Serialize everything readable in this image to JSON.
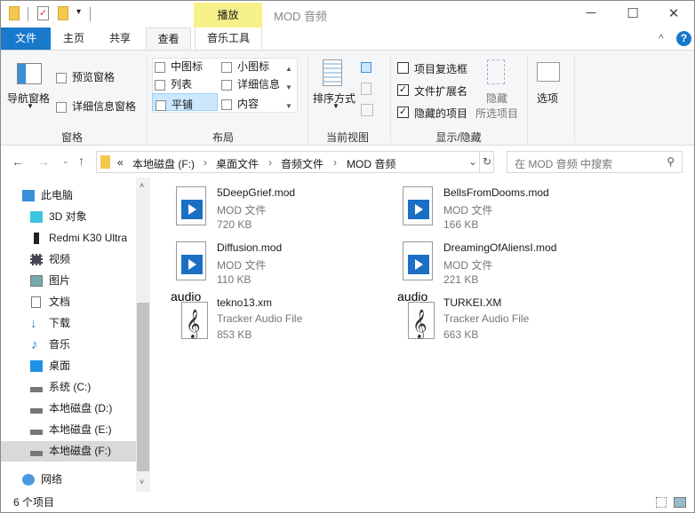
{
  "window": {
    "title": "MOD 音频",
    "minimize": "─",
    "maximize": "☐",
    "close": "✕"
  },
  "tabs": {
    "file": "文件",
    "home": "主页",
    "share": "共享",
    "view": "查看",
    "contextual_header": "播放",
    "music_tools": "音乐工具"
  },
  "ribbon": {
    "panes": {
      "nav_pane": "导航窗格",
      "preview_pane": "预览窗格",
      "details_pane": "详细信息窗格",
      "label": "窗格"
    },
    "layout": {
      "items": [
        "中图标",
        "小图标",
        "列表",
        "详细信息",
        "平铺",
        "内容"
      ],
      "selected": "平铺",
      "label": "布局"
    },
    "current_view": {
      "sort": "排序方式",
      "label": "当前视图"
    },
    "show_hide": {
      "item_checkboxes": "项目复选框",
      "item_checkboxes_checked": false,
      "file_extensions": "文件扩展名",
      "file_extensions_checked": true,
      "hidden_items": "隐藏的项目",
      "hidden_items_checked": true,
      "hide_selected_1": "隐藏",
      "hide_selected_2": "所选项目",
      "label": "显示/隐藏"
    },
    "options": "选项"
  },
  "address": {
    "overflow": "«",
    "crumbs": [
      "本地磁盘 (F:)",
      "桌面文件",
      "音频文件",
      "MOD 音频"
    ],
    "search_placeholder": "在 MOD 音频 中搜索"
  },
  "nav": {
    "items": [
      "此电脑",
      "3D 对象",
      "Redmi K30 Ultra",
      "视频",
      "图片",
      "文档",
      "下载",
      "音乐",
      "桌面",
      "系统 (C:)",
      "本地磁盘 (D:)",
      "本地磁盘 (E:)",
      "本地磁盘 (F:)",
      "网络"
    ],
    "selected": "本地磁盘 (F:)"
  },
  "files": [
    {
      "name": "5DeepGrief.mod",
      "type": "MOD 文件",
      "size": "720 KB",
      "icon": "media-icon"
    },
    {
      "name": "BellsFromDooms.mod",
      "type": "MOD 文件",
      "size": "166 KB",
      "icon": "media-icon"
    },
    {
      "name": "Diffusion.mod",
      "type": "MOD 文件",
      "size": "110 KB",
      "icon": "media-icon"
    },
    {
      "name": "DreamingOfAliensI.mod",
      "type": "MOD 文件",
      "size": "221 KB",
      "icon": "media-icon"
    },
    {
      "name": "tekno13.xm",
      "type": "Tracker Audio File",
      "size": "853 KB",
      "icon": "audio-clef-icon",
      "icon_label": "audio"
    },
    {
      "name": "TURKEI.XM",
      "type": "Tracker Audio File",
      "size": "663 KB",
      "icon": "audio-clef-icon",
      "icon_label": "audio"
    }
  ],
  "status": {
    "count": "6 个项目"
  },
  "colors": {
    "accent": "#1979ca",
    "contextual": "#f7f18a",
    "selected": "#cce8ff"
  }
}
